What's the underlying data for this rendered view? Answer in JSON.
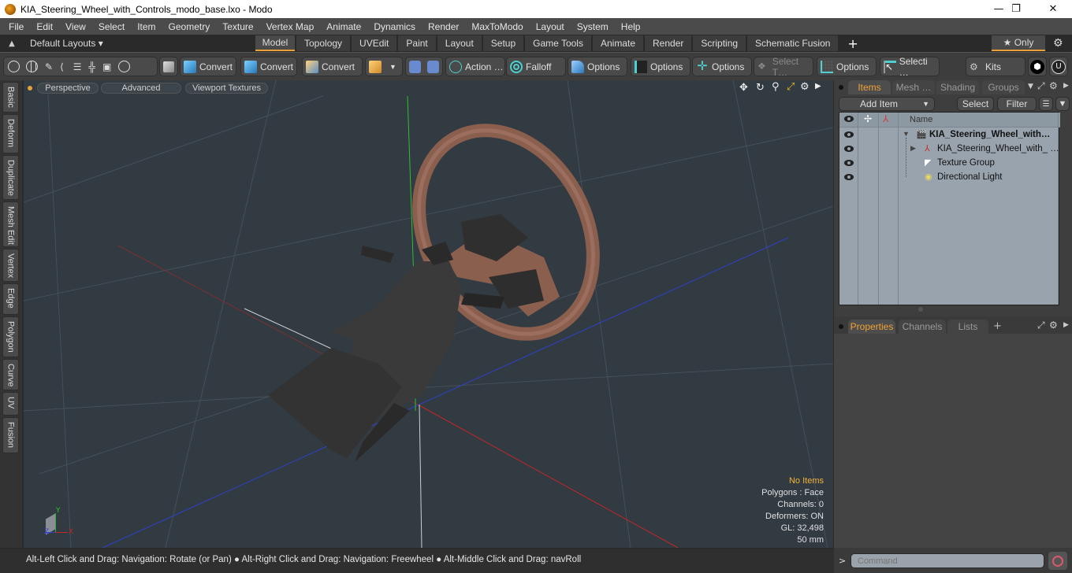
{
  "window": {
    "title": "KIA_Steering_Wheel_with_Controls_modo_base.lxo - Modo",
    "controls": {
      "minimize": "—",
      "restore": "❐",
      "close": "✕"
    }
  },
  "menu": [
    "File",
    "Edit",
    "View",
    "Select",
    "Item",
    "Geometry",
    "Texture",
    "Vertex Map",
    "Animate",
    "Dynamics",
    "Render",
    "MaxToModo",
    "Layout",
    "System",
    "Help"
  ],
  "layouts": {
    "dropdown": "Default Layouts ▾",
    "tabs": [
      "Model",
      "Topology",
      "UVEdit",
      "Paint",
      "Layout",
      "Setup",
      "Game Tools",
      "Animate",
      "Render",
      "Scripting",
      "Schematic Fusion"
    ],
    "active_tab": "Model",
    "add": "+",
    "only": "★ Only",
    "gear": "⚙"
  },
  "toolbar": {
    "convert1": "Convert",
    "convert2": "Convert",
    "convert3": "Convert",
    "action": "Action …",
    "falloff": "Falloff",
    "options1": "Options",
    "options2": "Options",
    "options3": "Options",
    "select_t": "Select T…",
    "options4": "Options",
    "selecti": "Selecti …",
    "kits": "Kits"
  },
  "sidetabs": [
    "Basic",
    "Deform",
    "Duplicate",
    "Mesh Edit",
    "Vertex",
    "Edge",
    "Polygon",
    "Curve",
    "UV",
    "Fusion"
  ],
  "viewport": {
    "view": "Perspective",
    "shading": "Advanced",
    "textures": "Viewport Textures",
    "info": {
      "selection": "No Items",
      "polygons": "Polygons : Face",
      "channels": "Channels: 0",
      "deformers": "Deformers: ON",
      "gl": "GL: 32,498",
      "scale": "50 mm"
    },
    "axes": {
      "x": "X",
      "y": "Y",
      "z": "Z"
    }
  },
  "status": "Alt-Left Click and Drag: Navigation: Rotate (or Pan) ● Alt-Right Click and Drag: Navigation: Freewheel ● Alt-Middle Click and Drag: navRoll",
  "items_panel": {
    "tabs": [
      "Items",
      "Mesh …",
      "Shading",
      "Groups"
    ],
    "active_tab": "Items",
    "add_item": "Add Item",
    "select": "Select",
    "filter": "Filter",
    "column_name": "Name",
    "rows": [
      {
        "name": "KIA_Steering_Wheel_with…",
        "type": "scene"
      },
      {
        "name": "KIA_Steering_Wheel_with_ …",
        "type": "mesh"
      },
      {
        "name": "Texture Group",
        "type": "texture"
      },
      {
        "name": "Directional Light",
        "type": "light"
      }
    ]
  },
  "props_panel": {
    "tabs": [
      "Properties",
      "Channels",
      "Lists"
    ],
    "active_tab": "Properties",
    "add": "+"
  },
  "command": {
    "prompt": ">",
    "placeholder": "Command"
  },
  "colors": {
    "accent": "#e8a135",
    "viewport_bg": "#323a42",
    "list_bg": "#98a3ad"
  }
}
